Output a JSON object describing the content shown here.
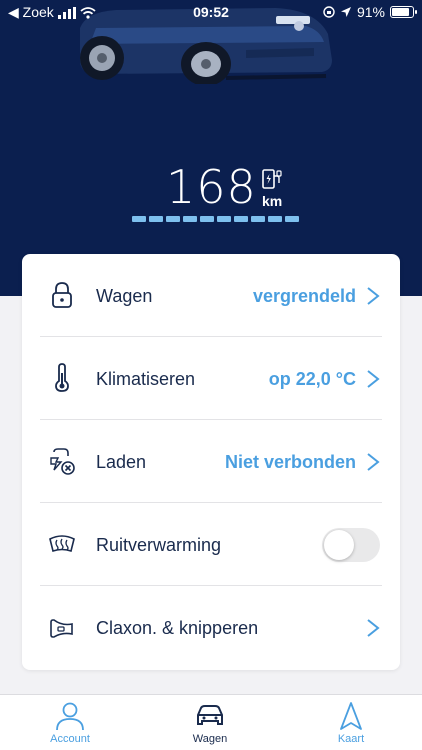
{
  "status_bar": {
    "back_label": "◀ Zoek",
    "time": "09:52",
    "battery_percent": "91%",
    "battery_level": 0.91
  },
  "vehicle": {
    "range_value": "168",
    "range_unit": "km",
    "range_segments": 10
  },
  "controls": [
    {
      "label": "Wagen",
      "value": "vergrendeld",
      "icon": "lock-icon"
    },
    {
      "label": "Klimatiseren",
      "value": "op 22,0 °C",
      "icon": "thermometer-icon"
    },
    {
      "label": "Laden",
      "value": "Niet verbonden",
      "icon": "charging-plug-icon"
    },
    {
      "label": "Ruitverwarming",
      "value": "",
      "icon": "window-heating-icon",
      "toggle_on": false
    },
    {
      "label": "Claxon. & knipperen",
      "value": "",
      "icon": "horn-icon"
    }
  ],
  "tabbar": {
    "account": "Account",
    "wagen": "Wagen",
    "kaart": "Kaart"
  },
  "colors": {
    "hero_background": "#0b1f4f",
    "accent": "#4a9fe0",
    "range_bar": "#7ec0ee",
    "text_primary": "#1a2b4d"
  }
}
